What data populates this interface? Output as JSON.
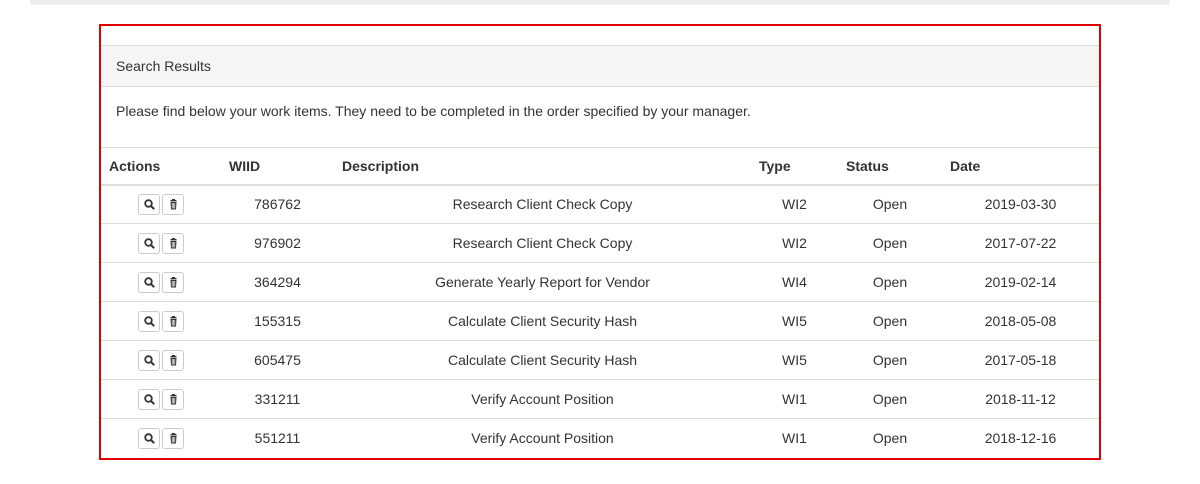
{
  "panel": {
    "heading": "Search Results",
    "intro": "Please find below your work items. They need to be completed in the order specified by your manager."
  },
  "table": {
    "headers": {
      "actions": "Actions",
      "wiid": "WIID",
      "description": "Description",
      "type": "Type",
      "status": "Status",
      "date": "Date"
    },
    "rows": [
      {
        "wiid": "786762",
        "description": "Research Client Check Copy",
        "type": "WI2",
        "status": "Open",
        "date": "2019-03-30"
      },
      {
        "wiid": "976902",
        "description": "Research Client Check Copy",
        "type": "WI2",
        "status": "Open",
        "date": "2017-07-22"
      },
      {
        "wiid": "364294",
        "description": "Generate Yearly Report for Vendor",
        "type": "WI4",
        "status": "Open",
        "date": "2019-02-14"
      },
      {
        "wiid": "155315",
        "description": "Calculate Client Security Hash",
        "type": "WI5",
        "status": "Open",
        "date": "2018-05-08"
      },
      {
        "wiid": "605475",
        "description": "Calculate Client Security Hash",
        "type": "WI5",
        "status": "Open",
        "date": "2017-05-18"
      },
      {
        "wiid": "331211",
        "description": "Verify Account Position",
        "type": "WI1",
        "status": "Open",
        "date": "2018-11-12"
      },
      {
        "wiid": "551211",
        "description": "Verify Account Position",
        "type": "WI1",
        "status": "Open",
        "date": "2018-12-16"
      }
    ],
    "row_actions": [
      "search-icon",
      "trash-icon"
    ]
  },
  "colors": {
    "panel_border": "#e00000",
    "heading_bg": "#f5f5f5",
    "divider": "#dddddd"
  }
}
